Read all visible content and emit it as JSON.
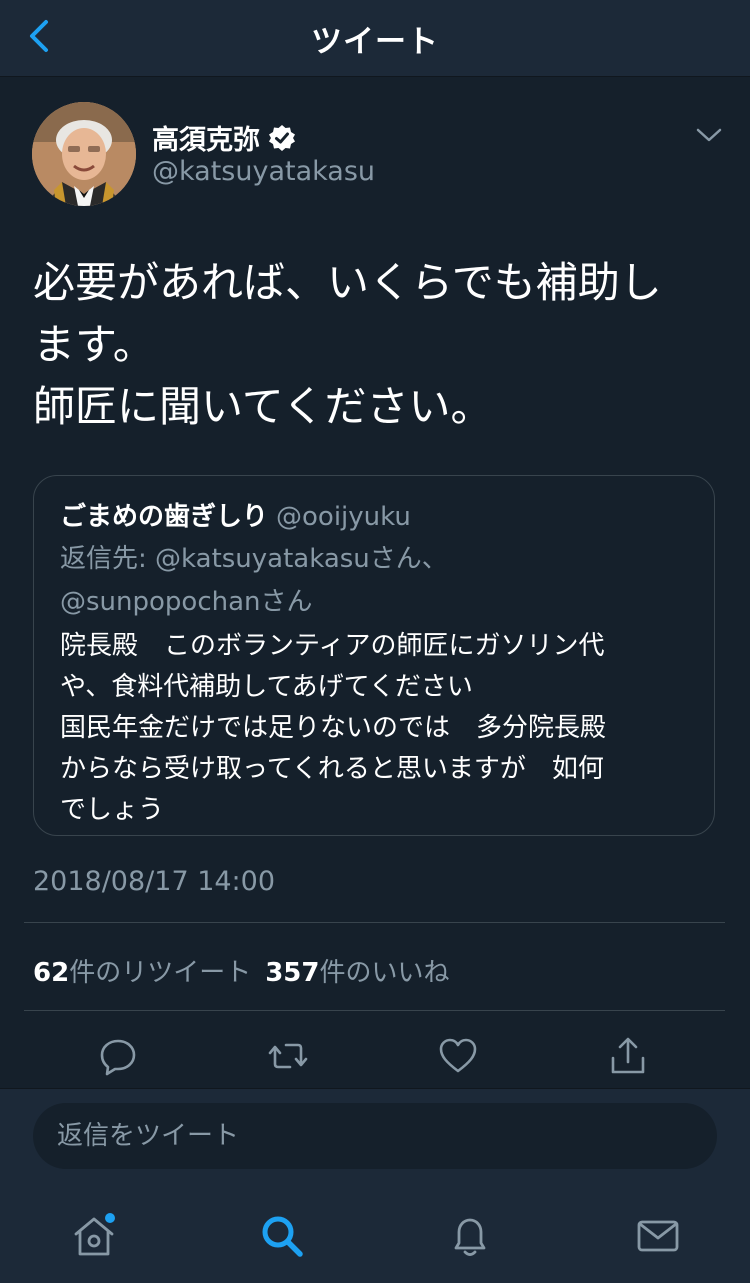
{
  "header": {
    "title": "ツイート"
  },
  "tweet": {
    "display_name": "高須克弥",
    "handle": "@katsuyatakasu",
    "text": "必要があれば、いくらでも補助し\nます。\n師匠に聞いてください。",
    "timestamp": "2018/08/17 14:00",
    "retweet_count": "62",
    "retweet_label": "件のリツイート",
    "like_count": "357",
    "like_label": "件のいいね"
  },
  "quote": {
    "display_name": "ごまめの歯ぎしり",
    "handle": "@ooijyuku",
    "reply_prefix": "返信先: ",
    "mention1": "@katsuyatakasuさん、",
    "mention2": "@sunpopochanさん",
    "text": "院長殿　このボランティアの師匠にガソリン代\nや、食料代補助してあげてください\n国民年金だけでは足りないのでは　多分院長殿\nからなら受け取ってくれると思いますが　如何\nでしょう"
  },
  "reply": {
    "placeholder": "返信をツイート"
  },
  "colors": {
    "background": "#15202b",
    "bar": "#1c2938",
    "accent": "#1da1f2",
    "muted": "#8899a6"
  },
  "icons": {
    "back": "chevron-left-icon",
    "verified": "verified-badge-icon",
    "caret": "chevron-down-icon",
    "reply": "reply-icon",
    "retweet": "retweet-icon",
    "like": "heart-icon",
    "share": "share-icon",
    "home": "home-icon",
    "search": "search-icon",
    "notifications": "bell-icon",
    "messages": "envelope-icon"
  }
}
